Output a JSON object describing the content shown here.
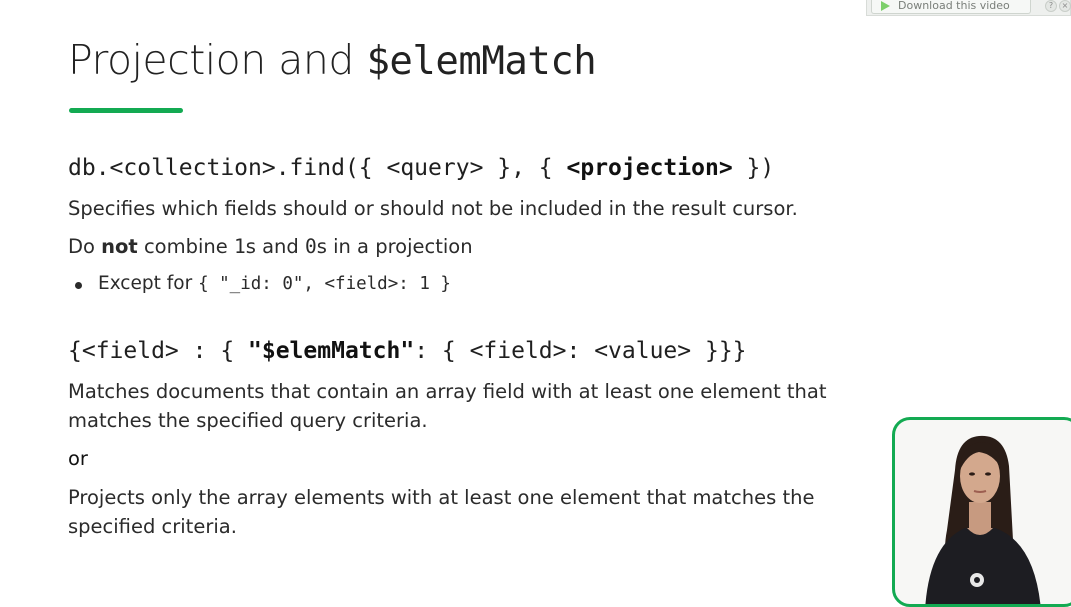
{
  "download_bar": {
    "label": "Download this video"
  },
  "slide": {
    "title_plain": "Projection and ",
    "title_code": "$elemMatch",
    "accent_color": "#13aa52",
    "projection_syntax": {
      "prefix": "db.<collection>.find({ <query> }, { ",
      "bold": "<projection>",
      "suffix": " })"
    },
    "projection_desc": "Specifies which fields should or should not be included in the result cursor.",
    "combine_note": {
      "pre": "Do ",
      "bold": "not",
      "mid1": " combine ",
      "one": "1",
      "mid2": "s and ",
      "zero": "0",
      "post": "s in a projection"
    },
    "bullet": {
      "label": "Except for ",
      "code": "{ \"_id: 0\", <field>: 1 }"
    },
    "elemmatch_syntax": {
      "prefix": "{<field> : { ",
      "bold": "\"$elemMatch\"",
      "suffix": ": { <field>: <value> }}}"
    },
    "elemmatch_desc_line1": "Matches documents that contain an array field with at least one element that",
    "elemmatch_desc_line2": "matches the specified query criteria.",
    "or": "or",
    "project_desc_line1": "Projects only the array elements with at least one element that matches the",
    "project_desc_line2": "specified criteria."
  }
}
